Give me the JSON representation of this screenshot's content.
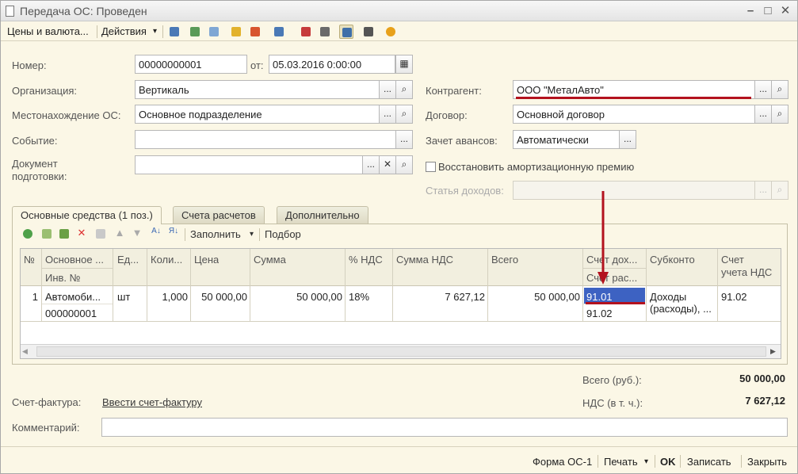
{
  "window": {
    "title": "Передача ОС: Проведен",
    "minimize": "–",
    "maximize": "□",
    "close": "✕"
  },
  "toolbar": {
    "prices_label": "Цены и валюта...",
    "actions_label": "Действия",
    "dropdown_glyph": "▾"
  },
  "header": {
    "number_label": "Номер:",
    "number_value": "00000000001",
    "from_label": "от:",
    "date_value": "05.03.2016  0:00:00",
    "org_label": "Организация:",
    "org_value": "Вертикаль",
    "location_label": "Местонахождение ОС:",
    "location_value": "Основное подразделение",
    "event_label": "Событие:",
    "event_value": "",
    "prepdoc_label_1": "Документ",
    "prepdoc_label_2": "подготовки:",
    "prepdoc_value": "",
    "counterparty_label": "Контрагент:",
    "counterparty_value": "ООО \"МеталАвто\"",
    "contract_label": "Договор:",
    "contract_value": "Основной договор",
    "advance_label": "Зачет авансов:",
    "advance_value": "Автоматически",
    "restore_checkbox_label": "Восстановить амортизационную премию",
    "income_article_label": "Статья доходов:",
    "income_article_value": ""
  },
  "buttons": {
    "select": "...",
    "search": "🔍",
    "clear": "✕"
  },
  "tabs": [
    {
      "label": "Основные средства (1 поз.)",
      "active": true
    },
    {
      "label": "Счета расчетов",
      "active": false
    },
    {
      "label": "Дополнительно",
      "active": false
    }
  ],
  "table_toolbar": {
    "fill_label": "Заполнить",
    "pick_label": "Подбор"
  },
  "table": {
    "headers": {
      "num": "№",
      "asset_1": "Основное ...",
      "asset_2": "Инв. №",
      "unit": "Ед...",
      "qty": "Коли...",
      "price": "Цена",
      "sum": "Сумма",
      "vat_rate": "% НДС",
      "vat_sum": "Сумма НДС",
      "total": "Всего",
      "account_1": "Счет дох...",
      "account_2": "Счет рас...",
      "subconto": "Субконто",
      "vat_account_1": "Счет",
      "vat_account_2": "учета НДС"
    },
    "rows": [
      {
        "num": "1",
        "asset": "Автомоби...",
        "inv": "000000001",
        "unit": "шт",
        "qty": "1,000",
        "price": "50 000,00",
        "sum": "50 000,00",
        "vat_rate": "18%",
        "vat_sum": "7 627,12",
        "total": "50 000,00",
        "income_account": "91.01",
        "expense_account": "91.02",
        "subconto_1": "Доходы",
        "subconto_2": "(расходы), ...",
        "vat_account": "91.02"
      }
    ]
  },
  "totals": {
    "total_label": "Всего (руб.):",
    "total_value": "50 000,00",
    "vat_label": "НДС (в т. ч.):",
    "vat_value": "7 627,12"
  },
  "invoice": {
    "label": "Счет-фактура:",
    "link": "Ввести счет-фактуру"
  },
  "comment": {
    "label": "Комментарий:",
    "value": ""
  },
  "bottom": {
    "form_os1": "Форма ОС-1",
    "print": "Печать",
    "ok": "OK",
    "save": "Записать",
    "close": "Закрыть"
  },
  "colors": {
    "window_bg": "#fbf7e6",
    "selection": "#3d62c2",
    "annotation_red": "#b3121e"
  }
}
